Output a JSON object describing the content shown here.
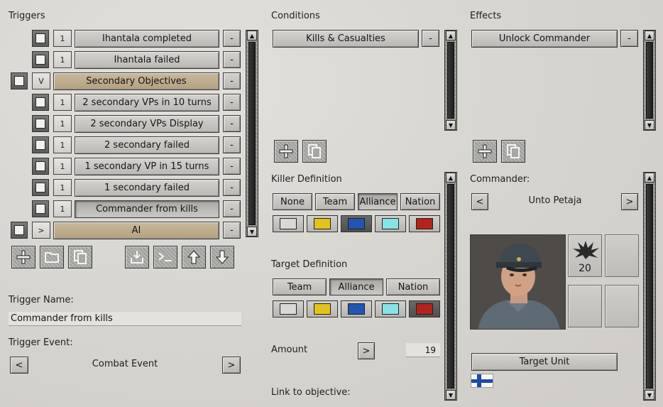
{
  "triggers": {
    "title": "Triggers",
    "items": [
      {
        "count": "1",
        "label": "Ihantala completed"
      },
      {
        "count": "1",
        "label": "Ihantala failed"
      },
      {
        "count": "V",
        "label": "Secondary Objectives"
      },
      {
        "count": "1",
        "label": "2 secondary VPs in 10 turns"
      },
      {
        "count": "1",
        "label": "2 secondary VPs Display"
      },
      {
        "count": "1",
        "label": "2 secondary failed"
      },
      {
        "count": "1",
        "label": "1 secondary VP in 15 turns"
      },
      {
        "count": "1",
        "label": "1 secondary failed"
      },
      {
        "count": "1",
        "label": "Commander from kills"
      },
      {
        "count": ">",
        "label": "AI"
      }
    ],
    "minus_label": "-",
    "name_label": "Trigger Name:",
    "name_value": "Commander from kills",
    "event_label": "Trigger Event:",
    "event_value": "Combat Event",
    "prev_label": "<",
    "next_label": ">"
  },
  "conditions": {
    "title": "Conditions",
    "items": [
      {
        "label": "Kills & Casualties"
      }
    ],
    "minus_label": "-",
    "killer_title": "Killer Definition",
    "killer_tabs": [
      "None",
      "Team",
      "Alliance",
      "Nation"
    ],
    "killer_selected": "Alliance",
    "killer_colors_selected": "blue",
    "target_title": "Target Definition",
    "target_tabs": [
      "Team",
      "Alliance",
      "Nation"
    ],
    "target_selected": "Alliance",
    "target_colors_selected": "red",
    "amount_label": "Amount",
    "amount_arrow": ">",
    "amount_value": "19",
    "link_label": "Link to objective:"
  },
  "effects": {
    "title": "Effects",
    "items": [
      {
        "label": "Unlock Commander"
      }
    ],
    "minus_label": "-",
    "commander_label": "Commander:",
    "commander_name": "Unto Petaja",
    "prev_label": "<",
    "next_label": ">",
    "ability_value": "20",
    "target_unit_label": "Target Unit",
    "flag": "Finland"
  },
  "colors": {
    "white": "#d8d8d8",
    "yellow": "#e3c21c",
    "blue": "#2255b0",
    "cyan": "#86e3e6",
    "red": "#b3231d",
    "tan": "#bfae8e"
  },
  "icons": {
    "trigger_toolbar": [
      "add-icon",
      "folder-icon",
      "copy-icon",
      "import-icon",
      "console-icon",
      "move-up-icon",
      "move-down-icon"
    ],
    "condition_toolbar": [
      "add-icon",
      "copy-icon"
    ],
    "effect_toolbar": [
      "add-icon",
      "copy-icon"
    ]
  }
}
